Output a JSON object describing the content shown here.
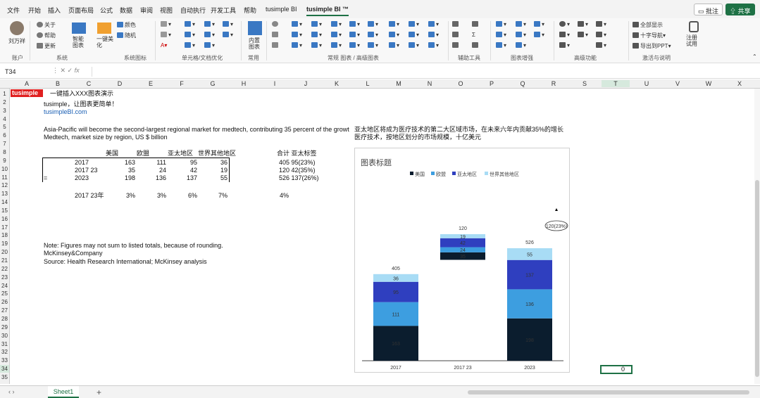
{
  "menubar": {
    "tabs": [
      "文件",
      "开始",
      "插入",
      "页面布局",
      "公式",
      "数据",
      "审阅",
      "视图",
      "自动执行",
      "开发工具",
      "帮助",
      "tusimple BI",
      "tusimple BI"
    ],
    "active_extra": "™",
    "comments": "批注",
    "share": "共享"
  },
  "ribbon": {
    "user": "刘万祥",
    "account_group": "账户",
    "about": "关于",
    "help": "帮助",
    "update": "更新",
    "system_group": "系统",
    "chart_btn1": "智能\n图表",
    "chart_btn2": "一键美\n化",
    "chart_group": "系统图标",
    "color1": "颜色",
    "color2": "随机",
    "cell_group": "单元格/文档优化",
    "data_group": "常用",
    "inner": "内置\n图表",
    "typical_group": "常规 图表 / 高级图表",
    "tools_group": "辅助工具",
    "chart_ops_group": "图表增强",
    "ppt": "导出到PPT",
    "all_show": "全部显示",
    "ten_sign": "十字导航",
    "font_group": "高级功能",
    "register": "注册\n试用",
    "register_group": "激活与说明"
  },
  "formula_bar": {
    "cell_ref": "T34",
    "fx": "fx",
    "value": ""
  },
  "columns": [
    "A",
    "B",
    "C",
    "D",
    "E",
    "F",
    "G",
    "H",
    "I",
    "J",
    "K",
    "L",
    "M",
    "N",
    "O",
    "P",
    "Q",
    "R",
    "S",
    "T",
    "U",
    "V",
    "W",
    "X"
  ],
  "rows": [
    "1",
    "2",
    "3",
    "4",
    "5",
    "6",
    "7",
    "8",
    "9",
    "10",
    "11",
    "12",
    "13",
    "14",
    "15",
    "16",
    "17",
    "18",
    "19",
    "20",
    "21",
    "22",
    "23",
    "24",
    "25",
    "26",
    "27",
    "28",
    "29",
    "30",
    "31",
    "32",
    "33",
    "34",
    "35"
  ],
  "sheet": {
    "tag": "tusimple",
    "title": "一键插入XXX图表演示",
    "slogan": "tusimple，让图表更简单！",
    "url": "tusimpleBI.com",
    "desc_en": "Asia-Pacific will become the second-largest regional market for medtech, contributing 35 percent of the growt",
    "desc_cn": "亚太地区将成为医疗技术的第二大区域市场，在未来六年内贡献35%的增长",
    "sub_en": "Medtech, market size by region, US $ billion",
    "sub_cn": "医疗技术，按地区划分的市场规模，十亿美元",
    "headers": [
      "美国",
      "欧盟",
      "亚太地区",
      "世界其他地区",
      "合计 亚太标签"
    ],
    "table": [
      {
        "label": "2017",
        "v1": "163",
        "v2": "111",
        "v3": "95",
        "v4": "36",
        "tot": "405 95(23%)"
      },
      {
        "label": "2017 23",
        "v1": "35",
        "v2": "24",
        "v3": "42",
        "v4": "19",
        "tot": "120 42(35%)"
      },
      {
        "label": "2023",
        "v1": "198",
        "v2": "136",
        "v3": "137",
        "v4": "55",
        "tot": "526 137(26%)"
      }
    ],
    "row11_mark": "=",
    "growth_label": "2017 23年",
    "growth": [
      "3%",
      "3%",
      "6%",
      "7%",
      "4%"
    ],
    "note": "Note: Figures may not sum to listed totals, because of rounding.",
    "company": "McKinsey&Company",
    "source": "Source: Health Research International; McKinsey analysis",
    "t34_value": "0"
  },
  "chart_data": {
    "type": "bar",
    "title": "图表标题",
    "categories": [
      "2017",
      "2017 23",
      "2023"
    ],
    "series": [
      {
        "name": "美国",
        "values": [
          163,
          35,
          198
        ],
        "color": "#0b1d2e"
      },
      {
        "name": "欧盟",
        "values": [
          111,
          24,
          136
        ],
        "color": "#3d9ee0"
      },
      {
        "name": "亚太地区",
        "values": [
          95,
          42,
          137
        ],
        "color": "#2f3fbf"
      },
      {
        "name": "世界其他地区",
        "values": [
          36,
          19,
          55
        ],
        "color": "#a8dcf5"
      }
    ],
    "totals": [
      "405",
      "120",
      "526"
    ],
    "waterfall_offset": [
      0,
      405,
      0
    ],
    "callout": "120(23%)",
    "legend": "top",
    "grid": false
  },
  "sheetbar": {
    "tab": "Sheet1",
    "add": "+"
  }
}
